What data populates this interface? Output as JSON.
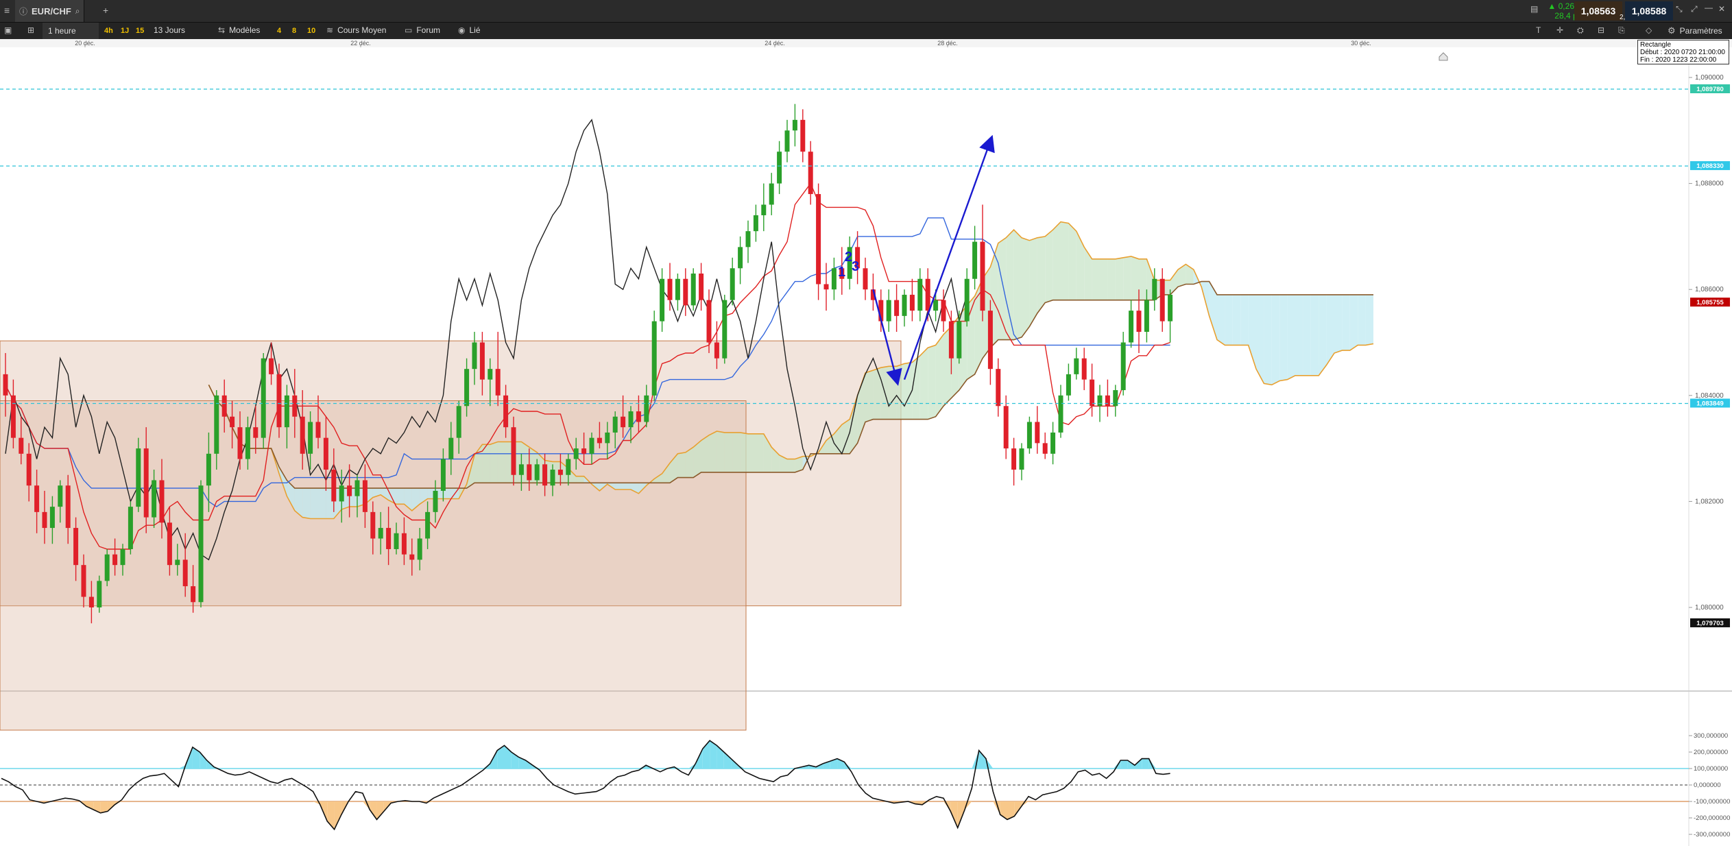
{
  "header": {
    "instrument": "EUR/CHF",
    "change_pct": "▲ 0,26 %",
    "change_pts": "28,4 pts",
    "bid": "1,08563",
    "ask": "1,08588",
    "spread": "2,5",
    "settings_label": "Paramètres"
  },
  "toolbar": {
    "timeframe": "1 heure",
    "tf_4h": "4h",
    "tf_1j": "1J",
    "tf_15": "15",
    "period": "13 Jours",
    "models": "Modèles",
    "pres_4": "4",
    "pres_8": "8",
    "pres_10": "10",
    "avg_price": "Cours Moyen",
    "forum": "Forum",
    "linked": "Lié"
  },
  "x_axis": {
    "date_labels": [
      "20 déc.",
      "22 déc.",
      "24 déc.",
      "28 déc.",
      "30 déc."
    ]
  },
  "price_axis": {
    "ticks": [
      "1,090000",
      "1,088000",
      "1,086000",
      "1,084000",
      "1,082000",
      "1,080000"
    ],
    "levels": {
      "upper_line": "1,089780",
      "mid_line": "1,088330",
      "lower_line": "1,083849",
      "current": "1,085755",
      "low_mark": "1,079703"
    }
  },
  "oscillator_axis": {
    "ticks": [
      "300,000000",
      "200,000000",
      "100,000000",
      "0,000000",
      "-100,000000",
      "-200,000000",
      "-300,000000"
    ]
  },
  "annotations": {
    "wave_labels": [
      "1",
      "2",
      "3"
    ]
  },
  "tooltip": {
    "line1": "Rectangle",
    "line2": "Début : 2020 0720 21:00:00",
    "line3": "Fin : 2020 1223 22:00:00"
  },
  "colors": {
    "bull": "#2aa02a",
    "bear": "#e0202a",
    "tenkan": "#e02020",
    "kijun": "#3366dd",
    "chikou": "#222222",
    "span_a": "#e8a030",
    "span_b": "#8a5a2a",
    "kumo_bull": "#c8e4c8",
    "kumo_bear": "#bfeaf2",
    "rect_fill": "#d9b29a",
    "cci_line": "#111111",
    "cci_pos": "#7fdff0",
    "cci_neg": "#f8c88a",
    "arrow": "#1a1ad0",
    "accent_green": "#23c723"
  },
  "chart_data": {
    "type": "candlestick",
    "title": "EUR/CHF",
    "interval": "1 heure",
    "ylim": [
      1.0786,
      1.091
    ],
    "x_date_ticks": [
      "20 déc.",
      "22 déc.",
      "24 déc.",
      "28 déc.",
      "30 déc."
    ],
    "candles_ohlc": [
      [
        1.0844,
        1.0848,
        1.0836,
        1.084
      ],
      [
        1.084,
        1.0843,
        1.083,
        1.0832
      ],
      [
        1.0832,
        1.0836,
        1.0827,
        1.0829
      ],
      [
        1.0829,
        1.0831,
        1.082,
        1.0823
      ],
      [
        1.0823,
        1.0826,
        1.0814,
        1.0818
      ],
      [
        1.0818,
        1.0822,
        1.0812,
        1.0815
      ],
      [
        1.0815,
        1.0821,
        1.0812,
        1.0819
      ],
      [
        1.0819,
        1.0824,
        1.0816,
        1.0823
      ],
      [
        1.0823,
        1.0825,
        1.0812,
        1.0815
      ],
      [
        1.0815,
        1.0817,
        1.0805,
        1.0808
      ],
      [
        1.0808,
        1.081,
        1.08,
        1.0802
      ],
      [
        1.0802,
        1.0805,
        1.0797,
        1.08
      ],
      [
        1.08,
        1.0806,
        1.0799,
        1.0805
      ],
      [
        1.0805,
        1.0811,
        1.0804,
        1.081
      ],
      [
        1.081,
        1.0813,
        1.0806,
        1.0808
      ],
      [
        1.0808,
        1.0812,
        1.0806,
        1.0811
      ],
      [
        1.0811,
        1.082,
        1.081,
        1.0819
      ],
      [
        1.0819,
        1.0832,
        1.0818,
        1.083
      ],
      [
        1.083,
        1.0834,
        1.0814,
        1.0817
      ],
      [
        1.0817,
        1.0826,
        1.0815,
        1.0824
      ],
      [
        1.0824,
        1.0828,
        1.0813,
        1.0816
      ],
      [
        1.0816,
        1.0819,
        1.0806,
        1.0808
      ],
      [
        1.0808,
        1.0812,
        1.0806,
        1.0809
      ],
      [
        1.0809,
        1.0814,
        1.0802,
        1.0804
      ],
      [
        1.0804,
        1.0808,
        1.0799,
        1.0801
      ],
      [
        1.0801,
        1.0824,
        1.08,
        1.0823
      ],
      [
        1.0823,
        1.0833,
        1.0818,
        1.0829
      ],
      [
        1.0829,
        1.0841,
        1.0826,
        1.084
      ],
      [
        1.084,
        1.0843,
        1.0833,
        1.0836
      ],
      [
        1.0836,
        1.0839,
        1.083,
        1.0834
      ],
      [
        1.0834,
        1.0837,
        1.0826,
        1.0828
      ],
      [
        1.0828,
        1.0836,
        1.0826,
        1.0834
      ],
      [
        1.0834,
        1.0838,
        1.0829,
        1.0832
      ],
      [
        1.0832,
        1.0848,
        1.083,
        1.0847
      ],
      [
        1.0847,
        1.085,
        1.0842,
        1.0844
      ],
      [
        1.0844,
        1.0846,
        1.0832,
        1.0834
      ],
      [
        1.0834,
        1.0842,
        1.083,
        1.084
      ],
      [
        1.084,
        1.0845,
        1.0832,
        1.0836
      ],
      [
        1.0836,
        1.0841,
        1.0826,
        1.0829
      ],
      [
        1.0829,
        1.0837,
        1.0826,
        1.0835
      ],
      [
        1.0835,
        1.084,
        1.083,
        1.0832
      ],
      [
        1.0832,
        1.0836,
        1.0822,
        1.0826
      ],
      [
        1.0826,
        1.083,
        1.0818,
        1.082
      ],
      [
        1.082,
        1.0826,
        1.0816,
        1.0823
      ],
      [
        1.0823,
        1.0827,
        1.0817,
        1.0821
      ],
      [
        1.0821,
        1.0825,
        1.0817,
        1.0824
      ],
      [
        1.0824,
        1.0827,
        1.0815,
        1.0818
      ],
      [
        1.0818,
        1.082,
        1.081,
        1.0813
      ],
      [
        1.0813,
        1.0818,
        1.081,
        1.0815
      ],
      [
        1.0815,
        1.0819,
        1.0808,
        1.0811
      ],
      [
        1.0811,
        1.0816,
        1.081,
        1.0814
      ],
      [
        1.0814,
        1.0817,
        1.0808,
        1.081
      ],
      [
        1.081,
        1.0813,
        1.0806,
        1.0809
      ],
      [
        1.0809,
        1.0815,
        1.0807,
        1.0813
      ],
      [
        1.0813,
        1.082,
        1.0811,
        1.0818
      ],
      [
        1.0818,
        1.0824,
        1.0816,
        1.0822
      ],
      [
        1.0822,
        1.083,
        1.082,
        1.0828
      ],
      [
        1.0828,
        1.0835,
        1.0825,
        1.0832
      ],
      [
        1.0832,
        1.0839,
        1.0829,
        1.0838
      ],
      [
        1.0838,
        1.0847,
        1.0836,
        1.0845
      ],
      [
        1.0845,
        1.0852,
        1.0842,
        1.085
      ],
      [
        1.085,
        1.0852,
        1.084,
        1.0843
      ],
      [
        1.0843,
        1.0847,
        1.0838,
        1.0845
      ],
      [
        1.0845,
        1.0852,
        1.0838,
        1.084
      ],
      [
        1.084,
        1.0842,
        1.0832,
        1.0834
      ],
      [
        1.0834,
        1.0836,
        1.0823,
        1.0825
      ],
      [
        1.0825,
        1.0829,
        1.0822,
        1.0827
      ],
      [
        1.0827,
        1.083,
        1.0822,
        1.0824
      ],
      [
        1.0824,
        1.0828,
        1.0823,
        1.0827
      ],
      [
        1.0827,
        1.0829,
        1.0821,
        1.0823
      ],
      [
        1.0823,
        1.0827,
        1.0821,
        1.0826
      ],
      [
        1.0826,
        1.0829,
        1.0823,
        1.0825
      ],
      [
        1.0825,
        1.0829,
        1.0823,
        1.0828
      ],
      [
        1.0828,
        1.0832,
        1.0826,
        1.083
      ],
      [
        1.083,
        1.0833,
        1.0827,
        1.0829
      ],
      [
        1.0829,
        1.0833,
        1.0827,
        1.0832
      ],
      [
        1.0832,
        1.0835,
        1.083,
        1.0831
      ],
      [
        1.0831,
        1.0835,
        1.0828,
        1.0833
      ],
      [
        1.0833,
        1.0837,
        1.083,
        1.0836
      ],
      [
        1.0836,
        1.084,
        1.0832,
        1.0834
      ],
      [
        1.0834,
        1.0838,
        1.0831,
        1.0837
      ],
      [
        1.0837,
        1.084,
        1.0833,
        1.0835
      ],
      [
        1.0835,
        1.0842,
        1.0834,
        1.084
      ],
      [
        1.084,
        1.0856,
        1.0839,
        1.0854
      ],
      [
        1.0854,
        1.0864,
        1.0852,
        1.0862
      ],
      [
        1.0862,
        1.0865,
        1.0856,
        1.0858
      ],
      [
        1.0858,
        1.0863,
        1.0856,
        1.0862
      ],
      [
        1.0862,
        1.0864,
        1.0855,
        1.0857
      ],
      [
        1.0857,
        1.0864,
        1.0856,
        1.0863
      ],
      [
        1.0863,
        1.0865,
        1.0856,
        1.0858
      ],
      [
        1.0858,
        1.086,
        1.0848,
        1.085
      ],
      [
        1.085,
        1.0854,
        1.0845,
        1.0847
      ],
      [
        1.0847,
        1.0859,
        1.0846,
        1.0858
      ],
      [
        1.0858,
        1.0866,
        1.0857,
        1.0864
      ],
      [
        1.0864,
        1.087,
        1.0861,
        1.0868
      ],
      [
        1.0868,
        1.0873,
        1.0865,
        1.0871
      ],
      [
        1.0871,
        1.0876,
        1.0869,
        1.0874
      ],
      [
        1.0874,
        1.088,
        1.0871,
        1.0876
      ],
      [
        1.0876,
        1.0882,
        1.0874,
        1.088
      ],
      [
        1.088,
        1.0888,
        1.0878,
        1.0886
      ],
      [
        1.0886,
        1.0892,
        1.0884,
        1.089
      ],
      [
        1.089,
        1.0895,
        1.0887,
        1.0892
      ],
      [
        1.0892,
        1.0894,
        1.0884,
        1.0886
      ],
      [
        1.0886,
        1.0888,
        1.0876,
        1.0878
      ],
      [
        1.0878,
        1.088,
        1.0858,
        1.0861
      ],
      [
        1.0861,
        1.0865,
        1.0856,
        1.086
      ],
      [
        1.086,
        1.0866,
        1.0858,
        1.0864
      ],
      [
        1.0864,
        1.0868,
        1.0859,
        1.0862
      ],
      [
        1.0862,
        1.087,
        1.086,
        1.0868
      ],
      [
        1.0868,
        1.0871,
        1.0861,
        1.0864
      ],
      [
        1.0864,
        1.0866,
        1.0858,
        1.086
      ],
      [
        1.086,
        1.0863,
        1.0856,
        1.0858
      ],
      [
        1.0858,
        1.086,
        1.0852,
        1.0854
      ],
      [
        1.0854,
        1.086,
        1.0852,
        1.0858
      ],
      [
        1.0858,
        1.0861,
        1.0852,
        1.0855
      ],
      [
        1.0855,
        1.086,
        1.0853,
        1.0859
      ],
      [
        1.0859,
        1.0862,
        1.0854,
        1.0856
      ],
      [
        1.0856,
        1.0864,
        1.0854,
        1.0862
      ],
      [
        1.0862,
        1.0864,
        1.0854,
        1.0856
      ],
      [
        1.0856,
        1.086,
        1.0854,
        1.0858
      ],
      [
        1.0858,
        1.086,
        1.0852,
        1.0854
      ],
      [
        1.0854,
        1.0856,
        1.0844,
        1.0847
      ],
      [
        1.0847,
        1.0856,
        1.0846,
        1.0854
      ],
      [
        1.0854,
        1.0864,
        1.0853,
        1.0862
      ],
      [
        1.0862,
        1.0872,
        1.086,
        1.0869
      ],
      [
        1.0869,
        1.0876,
        1.0854,
        1.0856
      ],
      [
        1.0856,
        1.0858,
        1.0842,
        1.0845
      ],
      [
        1.0845,
        1.0847,
        1.0836,
        1.0838
      ],
      [
        1.0838,
        1.084,
        1.0828,
        1.083
      ],
      [
        1.083,
        1.0832,
        1.0823,
        1.0826
      ],
      [
        1.0826,
        1.0831,
        1.0824,
        1.083
      ],
      [
        1.083,
        1.0836,
        1.0829,
        1.0835
      ],
      [
        1.0835,
        1.0838,
        1.0829,
        1.0831
      ],
      [
        1.0831,
        1.0833,
        1.0828,
        1.0829
      ],
      [
        1.0829,
        1.0835,
        1.0827,
        1.0833
      ],
      [
        1.0833,
        1.0842,
        1.0832,
        1.084
      ],
      [
        1.084,
        1.0846,
        1.0839,
        1.0844
      ],
      [
        1.0844,
        1.0849,
        1.0843,
        1.0847
      ],
      [
        1.0847,
        1.0849,
        1.0841,
        1.0843
      ],
      [
        1.0843,
        1.0846,
        1.0836,
        1.0838
      ],
      [
        1.0838,
        1.0842,
        1.0835,
        1.084
      ],
      [
        1.084,
        1.0843,
        1.0836,
        1.0838
      ],
      [
        1.0838,
        1.0842,
        1.0836,
        1.0841
      ],
      [
        1.0841,
        1.0852,
        1.084,
        1.085
      ],
      [
        1.085,
        1.0858,
        1.0849,
        1.0856
      ],
      [
        1.0856,
        1.086,
        1.0848,
        1.0852
      ],
      [
        1.0852,
        1.086,
        1.085,
        1.0858
      ],
      [
        1.0858,
        1.0864,
        1.0856,
        1.0862
      ],
      [
        1.0862,
        1.0864,
        1.0852,
        1.0854
      ],
      [
        1.0854,
        1.086,
        1.085,
        1.0859
      ]
    ],
    "price_levels": [
      1.08978,
      1.08833,
      1.083849,
      1.085755,
      1.079703
    ],
    "oscillator": {
      "ylim": [
        -300,
        300
      ],
      "levels": [
        100,
        0,
        -100
      ],
      "values": [
        40,
        20,
        -10,
        -30,
        -90,
        -100,
        -110,
        -100,
        -90,
        -80,
        -85,
        -95,
        -130,
        -150,
        -170,
        -160,
        -120,
        -90,
        -30,
        10,
        40,
        55,
        60,
        70,
        30,
        -10,
        120,
        230,
        200,
        150,
        110,
        90,
        70,
        60,
        65,
        80,
        60,
        40,
        20,
        10,
        30,
        40,
        15,
        -10,
        -40,
        -120,
        -220,
        -270,
        -180,
        -100,
        -40,
        -50,
        -150,
        -210,
        -160,
        -110,
        -100,
        -95,
        -100,
        -100,
        -110,
        -80,
        -60,
        -40,
        -20,
        0,
        30,
        60,
        90,
        130,
        210,
        240,
        200,
        170,
        150,
        120,
        90,
        40,
        0,
        -20,
        -40,
        -55,
        -50,
        -45,
        -40,
        -20,
        20,
        50,
        60,
        80,
        90,
        120,
        100,
        80,
        100,
        110,
        80,
        60,
        130,
        220,
        270,
        240,
        200,
        160,
        120,
        80,
        60,
        40,
        30,
        20,
        50,
        60,
        100,
        110,
        120,
        110,
        130,
        145,
        160,
        140,
        80,
        0,
        -50,
        -80,
        -90,
        -100,
        -110,
        -105,
        -100,
        -115,
        -120,
        -90,
        -70,
        -80,
        -160,
        -260,
        -150,
        -20,
        210,
        160,
        -40,
        -180,
        -210,
        -190,
        -130,
        -70,
        -90,
        -60,
        -50,
        -40,
        -20,
        20,
        80,
        90,
        60,
        70,
        40,
        80,
        150,
        150,
        120,
        160,
        160,
        70,
        65,
        70
      ],
      "note": "CCI-type oscillator with +100 / -100 bands"
    }
  }
}
